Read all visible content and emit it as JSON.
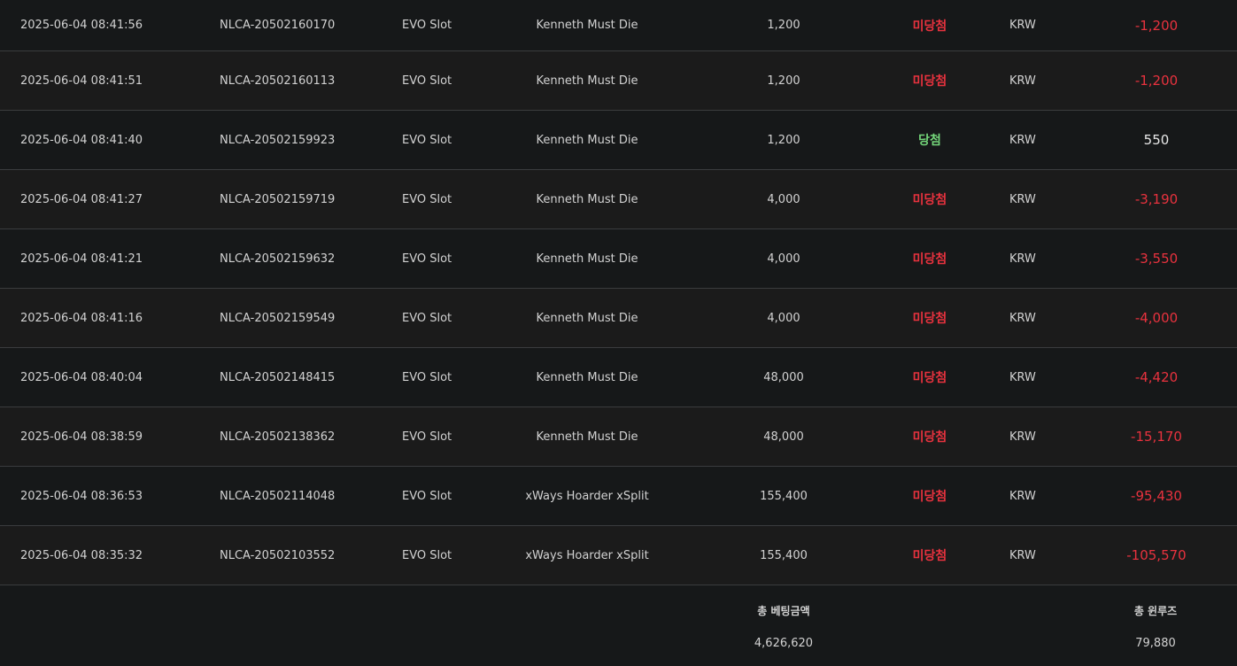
{
  "rows": [
    {
      "date": "2025-06-04 08:41:56",
      "id": "NLCA-20502160170",
      "provider": "EVO Slot",
      "game": "Kenneth Must Die",
      "bet": "1,200",
      "status": "미당첨",
      "status_type": "lose",
      "currency": "KRW",
      "win": "-1,200",
      "win_type": "neg"
    },
    {
      "date": "2025-06-04 08:41:51",
      "id": "NLCA-20502160113",
      "provider": "EVO Slot",
      "game": "Kenneth Must Die",
      "bet": "1,200",
      "status": "미당첨",
      "status_type": "lose",
      "currency": "KRW",
      "win": "-1,200",
      "win_type": "neg"
    },
    {
      "date": "2025-06-04 08:41:40",
      "id": "NLCA-20502159923",
      "provider": "EVO Slot",
      "game": "Kenneth Must Die",
      "bet": "1,200",
      "status": "당첨",
      "status_type": "win",
      "currency": "KRW",
      "win": "550",
      "win_type": "pos"
    },
    {
      "date": "2025-06-04 08:41:27",
      "id": "NLCA-20502159719",
      "provider": "EVO Slot",
      "game": "Kenneth Must Die",
      "bet": "4,000",
      "status": "미당첨",
      "status_type": "lose",
      "currency": "KRW",
      "win": "-3,190",
      "win_type": "neg"
    },
    {
      "date": "2025-06-04 08:41:21",
      "id": "NLCA-20502159632",
      "provider": "EVO Slot",
      "game": "Kenneth Must Die",
      "bet": "4,000",
      "status": "미당첨",
      "status_type": "lose",
      "currency": "KRW",
      "win": "-3,550",
      "win_type": "neg"
    },
    {
      "date": "2025-06-04 08:41:16",
      "id": "NLCA-20502159549",
      "provider": "EVO Slot",
      "game": "Kenneth Must Die",
      "bet": "4,000",
      "status": "미당첨",
      "status_type": "lose",
      "currency": "KRW",
      "win": "-4,000",
      "win_type": "neg"
    },
    {
      "date": "2025-06-04 08:40:04",
      "id": "NLCA-20502148415",
      "provider": "EVO Slot",
      "game": "Kenneth Must Die",
      "bet": "48,000",
      "status": "미당첨",
      "status_type": "lose",
      "currency": "KRW",
      "win": "-4,420",
      "win_type": "neg"
    },
    {
      "date": "2025-06-04 08:38:59",
      "id": "NLCA-20502138362",
      "provider": "EVO Slot",
      "game": "Kenneth Must Die",
      "bet": "48,000",
      "status": "미당첨",
      "status_type": "lose",
      "currency": "KRW",
      "win": "-15,170",
      "win_type": "neg"
    },
    {
      "date": "2025-06-04 08:36:53",
      "id": "NLCA-20502114048",
      "provider": "EVO Slot",
      "game": "xWays Hoarder xSplit",
      "bet": "155,400",
      "status": "미당첨",
      "status_type": "lose",
      "currency": "KRW",
      "win": "-95,430",
      "win_type": "neg"
    },
    {
      "date": "2025-06-04 08:35:32",
      "id": "NLCA-20502103552",
      "provider": "EVO Slot",
      "game": "xWays Hoarder xSplit",
      "bet": "155,400",
      "status": "미당첨",
      "status_type": "lose",
      "currency": "KRW",
      "win": "-105,570",
      "win_type": "neg"
    }
  ],
  "footer": {
    "total_bet_label": "총 베팅금액",
    "total_bet_value": "4,626,620",
    "total_winloss_label": "총 윈루즈",
    "total_winloss_value": "79,880"
  },
  "colors": {
    "lose": "#e8323e",
    "win": "#74d67a",
    "background": "#1a1c1d"
  }
}
